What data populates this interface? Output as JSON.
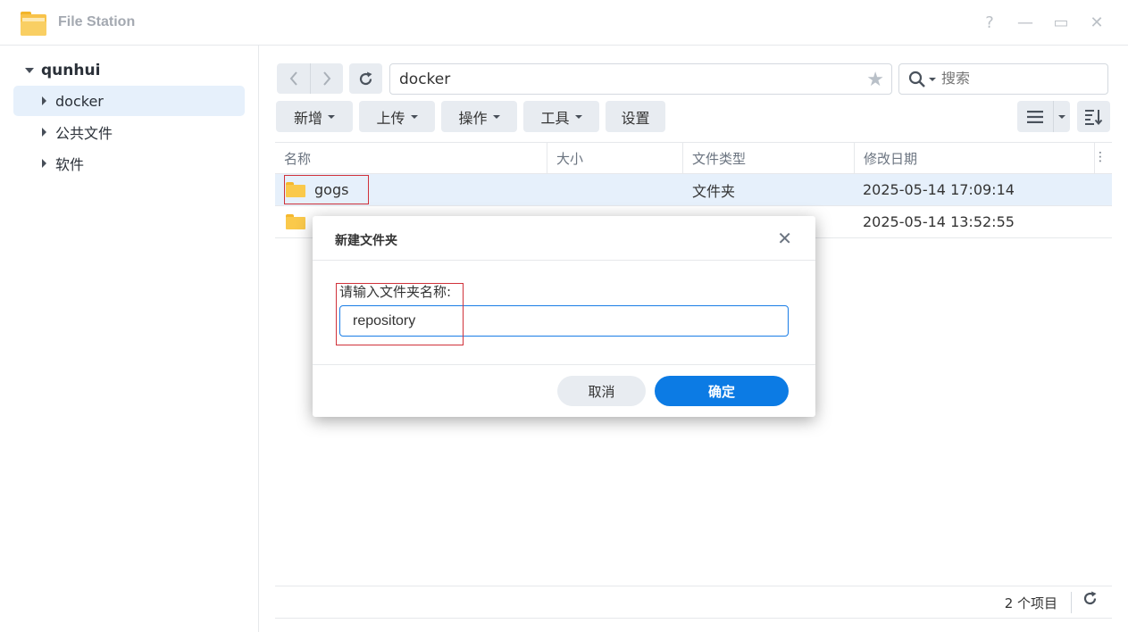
{
  "window": {
    "title": "File Station",
    "help_glyph": "?",
    "minimize_glyph": "—",
    "maximize_glyph": "▭",
    "close_glyph": "✕"
  },
  "sidebar": {
    "root": "qunhui",
    "items": [
      {
        "label": "docker",
        "selected": true
      },
      {
        "label": "公共文件",
        "selected": false
      },
      {
        "label": "软件",
        "selected": false
      }
    ]
  },
  "toolbar": {
    "path": "docker",
    "search_placeholder": "搜索",
    "buttons": [
      "新增",
      "上传",
      "操作",
      "工具",
      "设置"
    ]
  },
  "table": {
    "columns": [
      "名称",
      "大小",
      "文件类型",
      "修改日期"
    ],
    "rows": [
      {
        "name": "gogs",
        "size": "",
        "type": "文件夹",
        "modified": "2025-05-14 17:09:14",
        "selected": true
      },
      {
        "name": "",
        "size": "",
        "type": "",
        "modified": "2025-05-14 13:52:55",
        "selected": false
      }
    ]
  },
  "footer": {
    "count": "2 个项目"
  },
  "dialog": {
    "title": "新建文件夹",
    "label": "请输入文件夹名称:",
    "input_value": "repository",
    "cancel": "取消",
    "ok": "确定"
  },
  "colors": {
    "accent": "#0c7be4",
    "selection": "#e6f0fb",
    "annotation": "#d0323a",
    "folder": "#fac94b"
  }
}
